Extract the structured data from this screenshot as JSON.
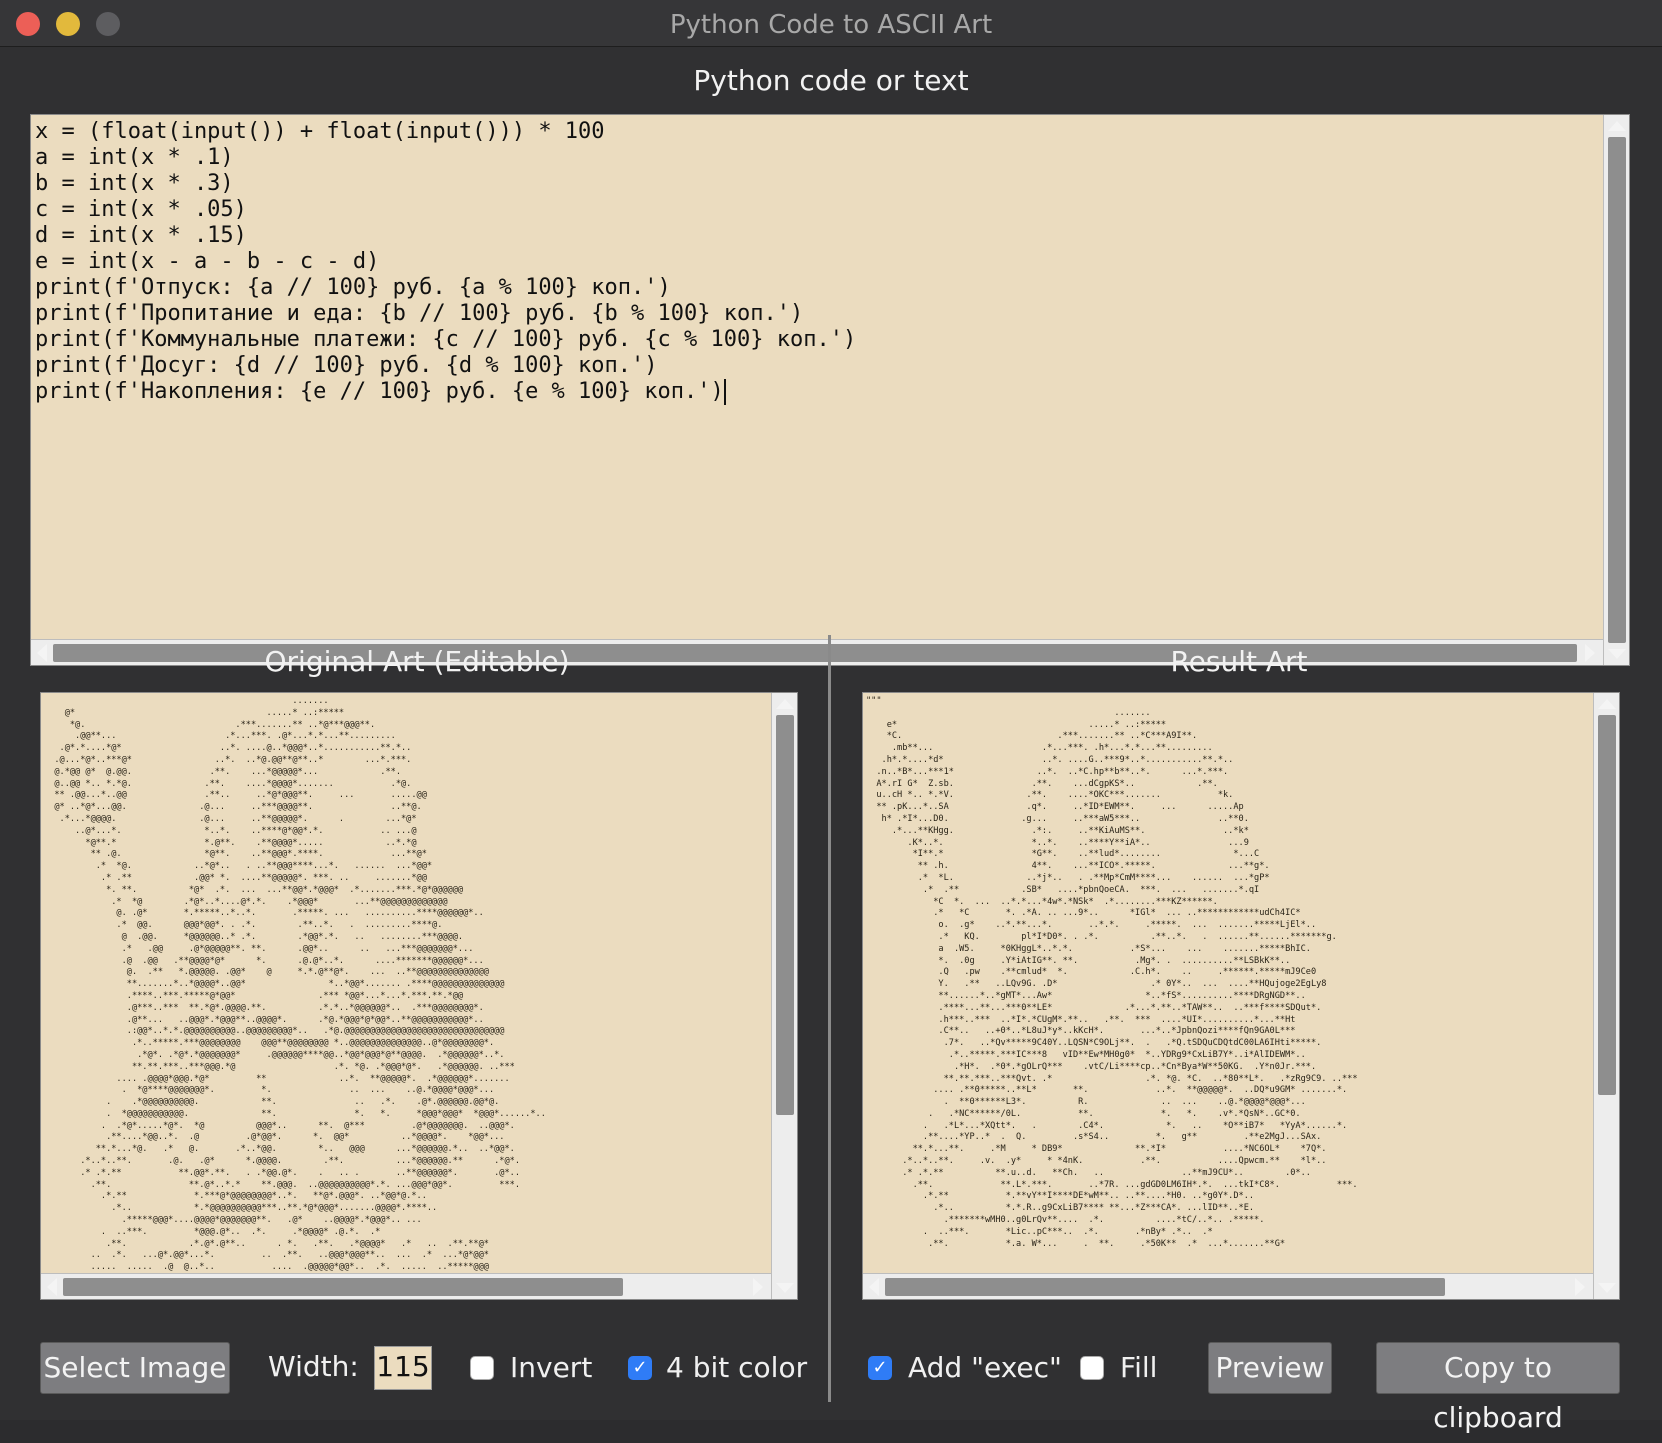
{
  "window": {
    "title": "Python Code to ASCII Art"
  },
  "code_section": {
    "title": "Python code or text",
    "lines": [
      "x = (float(input()) + float(input())) * 100",
      "a = int(x * .1)",
      "b = int(x * .3)",
      "c = int(x * .05)",
      "d = int(x * .15)",
      "e = int(x - a - b - c - d)",
      "print(f'Отпуск: {a // 100} руб. {a % 100} коп.')",
      "print(f'Пропитание и еда: {b // 100} руб. {b % 100} коп.')",
      "print(f'Коммунальные платежи: {c // 100} руб. {c % 100} коп.')",
      "print(f'Досуг: {d // 100} руб. {d % 100} коп.')",
      "print(f'Накопления: {e // 100} руб. {e % 100} коп.')"
    ]
  },
  "original_art": {
    "title": "Original Art (Editable)",
    "lines": [
      "                                                .......",
      "    @*                                     .....* ..:*****",
      "     *@.                             .***.......** ..*@***@@@**.",
      "      .@@**...                     .*...***. .@*...*.*...**.........",
      "   .@*.*....*@*                   ..*. ....@..*@@@*..*...........**.*..",
      "  .@...*@*..***@*                ..*.  ..*@.@@**@**..*        ...*.***.",
      "  @.*@@ @*  @.@@.               .**.    ...*@@@@@*...            .**.",
      "  @..@@ *.. *.*@.              .**.    ....*@@@@*.......           .*@.",
      "  ** .@@...*..@@               .**..     ..*@*@@@**.     ...       .....@@",
      "  @* ..*@*...@@.              .@...     ..***@@@@**.               ..**@.",
      "   .*...*@@@@.                .@...     ..**@@@@@*.      .        ...*@*",
      "      ..@*...*.                *..*.    ..****@*@@*.*.           .. ...@",
      "        *@**.*                 *.@**.    .**@@@@*.....            ..*.*@",
      "         ** .@.                *@**.    ..**@@@*.****.             ...**@*",
      "          .*  *@.            ..*@*..   . ..**@@@****...*.   ......  ...*@@*",
      "           .* .**            .@@* *.  ....**@@@@@*. ***. ..     .......*@@",
      "            *. **.          *@*  .*.  ...  ...**@@*.*@@@*  .*.......***.*@*@@@@@@",
      "             .*  *@        .*@*..*....@*.*.    .*@@@*       ...**@@@@@@@@@@@@@",
      "              @. .@*       *.*****..*..*.       .*****. ...   ..........****@@@@@@*..",
      "              .*  @@.      @@@*@@*. . .*.        .**..*.   .  .........****@.",
      "               @  .@@.     *@@@@@@..* .*.        .*@@*.*.   ..   ........***@@@@.",
      "               .*   .@@     .@*@@@@@**. **.      .@@*..      ..   ...***@@@@@@@*...",
      "               .@  .@@   .**@@@@*@*      *.      .@.@*..*.      ....*******@@@@@@*...",
      "                @.  .**   *.@@@@@. .@@*    @     *.*.@**@*.    ...  ..**@@@@@@@@@@@@@@",
      "                **.......*..*@@@@*..@@*                *..*@@*....... .****@@@@@@@@@@@@@@",
      "                .****..***.*****@*@@*                .*** *@@*...*...*.***.**.*@@",
      "                .@***..***  **.*@*.@@@@.**.          .*.*..*@@@@@@*..  .***@@@@@@@@*.",
      "                .@**...   ..@@@*.*@@@**..@@@@*.      .*@.*@@@*@*@@*..**@@@@@@@@@@@*..",
      "                .:@@*..*.*.@@@@@@@@@@..@@@@@@@@@*..   .*@.@@@@@@@@@@@@@@@@@@@@@@@@@@@@@@@",
      "                 .*..*****.***@@@@@@@@    @@@**@@@@@@@@ *..@@@@@@@@@@@@@@..@*@@@@@@@@*.",
      "                  .*@*. .*@*.*@@@@@@@*     .@@@@@@****@@..*@@*@@@*@**@@@@.  .*@@@@@@*..*.",
      "                 **.**.***..***@@@.*@                   .*. *@. .*@@@*@*.   .*@@@@@@. ..***",
      "              .... .@@@@*@@@.*@*         **              ..*.  **@@@@@*.  .*@@@@@@*.......",
      "               .  *@****@@@@@@@*.         *.               ..  ...    ..@.*@@@@*@@@*...",
      "            .    .*@@@@@@@@@@.            **.               ..   .*.    .@*.@@@@@@.@@*@.",
      "            .  *@@@@@@@@@@@.              **.               *.   *.     *@@@*@@@*  *@@@*......*..",
      "           .  .*@*.....*@*.  *@          @@@*..      **.  @***         .@*@@@@@@@.  ..@@@*.",
      "            .**....*@@..*.  .@         .@*@@*.      *.  @@*          ..*@@@@*.    *@@*...",
      "          **.*...*@.   .*   @.       .*..*@@.        *..   @@@      ...*@@@@@@.*..  ..*@@*.",
      "       .*..*..**.       .@.   .@*      *.@@@@.        .**.          ...*@@@@@@.**      .*@*.",
      "       .* .*.**           **.@@*.**.   . .*@@.@*.    .   .. .       ..**@@@@@@*.       .@*..",
      "         .**.               **.@*..*.*    **.@@@.  ..@@@@@@@@@@*.*. ...@@@*@@*.         ***.",
      "           .*.**             *.***@*@@@@@@@@*..*.   **@*.@@@*. ..*@@*@.*..",
      "             .*..            *.*@@@@@@@@@@***..**.*@*@@@*.......@@@@*.****..",
      "               .*****@@@*....@@@@*@@@@@@@**.   .@*    ..@@@@*.*@@@*.. ...",
      "           .  ..***.         *@@@.@*..  .*.     .*@@@@* .@.*.  .*",
      "            .**.            .*.@*.@**..      . *.   .**.   .*@@@@*   .*   ..  .**.**@*",
      "         ..  .*.   ...@*.@@*...*.         ..  .**.   ..@@@*@@@**..  ...  .*  ...*@*@@*",
      "         .....  .....  .@  @..*..           ....  .@@@@@*@@*..  .*.  .....  ..*****@@@"
    ]
  },
  "result_art": {
    "title": "Result Art",
    "lines": [
      "\"\"\"",
      "                                                .......",
      "    e*                                     .....* ..:*****",
      "    *C.                              .***.......** ..*C***A9I**.",
      "     .mb**...                     .*...***. .h*...*.*...**.........",
      "   .h*.*....*d*                   ..*. ....G..***9*..*...........**.*..",
      "  .n..*B*...***1*                ..*.  ..*C.hp**b**..*.      ...*.***.",
      "  A*.rI G*  Z.sb.               .**.    ...dCgpKS*..            .**.",
      "  u..cH *.. *.*V.              .**.    ....*OKC***.......           *k.",
      "  ** .pK...*..SA               .q*.     ..*ID*EWM**.     ...      .....Ap",
      "   h* .*I*...D0.              .g...     ..***aW5***..               ..**0.",
      "     .*...**KHgg.               .*:.     ..**KiAuMS**.               ..*k*",
      "        .K*..*.                 *..*.    ..****Y**iA*..               ...9",
      "         *I**.*                 *G**.    ..**lud*........              *...C",
      "          ** .h.                4**.    ...**ICO*.*****.              ...**g*.",
      "          .*  *L.              ..*j*..   . .**Mp*CmM****...    ......  ...*gP*",
      "           .*  .**            .SB*   ....*pbnQoeCA.  ***.  ...   .......*.qI",
      "             *C  *.  ...  ..*.*...*4w*.*NSk*  .*........***KZ******.",
      "             .*   *C       *. .*A. .. ...9*..      *IGl*  ... ..************udCh4IC*",
      "              o.  .g*    ..*.**...*.       ..*.*.     .*****.  ...  .......*****LjEl*..",
      "              .*   KQ.        pl*I*D0*. . .*.          .**..*.   .  ......**......*******g.",
      "              a  .W5.     *0KHggL*..*.*.           .*S*...    ...    .......*****BhIC.",
      "              *.  .0g     .Y*iAtIG**. **.           .Mg*. .  ..........**LSBkK**..",
      "              .Q   .pw    .**cmlud*  *.            .C.h*.    ..     .******.*****mJ9Ce0",
      "              Y.   .**   ..LQv9G. .D*                  .* 0Y*..  ...  ....**HQujoge2EgLy8",
      "              **......*..*gMT*...Aw*                  *..*fS*..........****DRgNGD**..",
      "              .****...**...***0**LE*              .*...*.**..*TAW**..  ..***f****SDQut*.",
      "              .h***..***  ..*I*.*CUgM*.**..   .**.  ***  ....*UI*..........*...**Ht",
      "              .C**..   ..+0*..*L8uJ*y*..kKcH*.       ...*..*JpbnQozi****fQn9GA0L***",
      "               .7*.   ..*Qv*****9C40Y..LQSN*C9OLj**.  .   .*Q.tSDQuCDQtdC00LA6IHti*****.",
      "                .*..*****.***IC***8   vID**Ew*MH0g0*  *..YDRg9*CxLiB7Y*..i*AlIDEWM*..",
      "                 .*H*.  .*0*.*gOLrQ***    .vtC/Li****cp..*Cn*Bya*W**50KG.  .Y*n0Jr.***.",
      "               **.**.***..***Qvt. .*                  .*. *@. *C.  ..*80**L*.   .*zRg9C9. ..***",
      "             .... .**0*****..**L*       **.             ..*.  **@@@@@*.  ..DQ*u9GM* .......*.",
      "               .  **0******L3*.          R.              ..  ...    ..@.*@@@@*@@@*...",
      "            .   .*NC******/0L.           **.             *.   *.    .v*.*QsN*..GC*0.",
      "           .   .*L*...*XQtt*.   .        .C4*.            *.   ..    *O**iB7*   *YyA*......*.",
      "           .**....*YP..*  .  Q.         .s*S4..         *.   g**         .**e2MgJ...SAx.",
      "         **.*...**.     .*M     * DB9*              **.*I*           ....*NC6OL*    *7Q*.",
      "       .*..*..**.     .v.  .y*     * *4nK.           .**.           ....Qpwcm.**    *l*..",
      "       .* .*.**          **.u..d.   **Ch.   ..               ..**mJ9CU*..        .0*..",
      "         .**.             **.L*.***.       ..*7R. ...gdGD0LM6IH*.*.  ...tkI*C8*.           ***.",
      "           .*.**           *.**vY**I****DE*wM**.. ..**....*H0. ..*g0Y*.D*..",
      "             .*..          *.*.R..g9CxLiB7**** **...*Z***CA*. ...lID**..*E.",
      "               .*******wMH0..g0LrQv**....  .*.          ....*tC/..*.. .*****.",
      "           .  ..***.       *Lic..pC***..  .*.       .*nBy* .*..  .*",
      "            .**.           *.a. W*...     .  **.     .*50K**  .*  ...*.......**G*"
    ]
  },
  "controls": {
    "select_image_label": "Select Image",
    "width_label": "Width:",
    "width_value": "115",
    "invert_label": "Invert",
    "invert_checked": false,
    "four_bit_label": "4 bit color",
    "four_bit_checked": true,
    "add_exec_label": "Add \"exec\"",
    "add_exec_checked": true,
    "fill_label": "Fill",
    "fill_checked": false,
    "preview_label": "Preview",
    "copy_label": "Copy to clipboard",
    "check_mark": "✓"
  },
  "colors": {
    "panel_bg": "#ebdcbf",
    "window_bg": "#303032",
    "accent": "#2f7cf6",
    "close": "#ec5f57",
    "minimize": "#e2b93c"
  }
}
